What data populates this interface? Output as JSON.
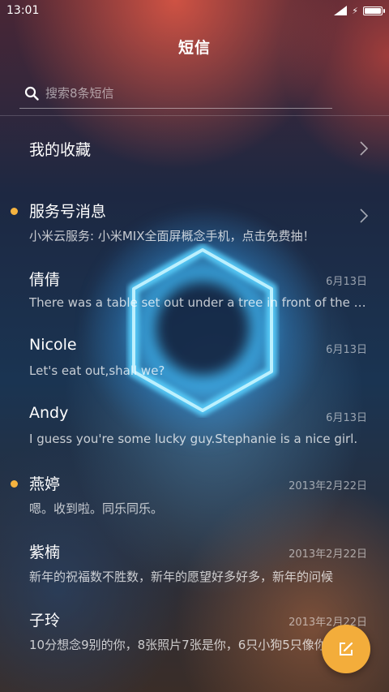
{
  "status_bar": {
    "time": "13:01",
    "charge_symbol": "⚡"
  },
  "header": {
    "title": "短信"
  },
  "search": {
    "placeholder": "搜索8条短信"
  },
  "favorites": {
    "label": "我的收藏"
  },
  "messages": [
    {
      "name": "服务号消息",
      "preview": "小米云服务: 小米MIX全面屏概念手机，点击免费抽！",
      "date": "",
      "unread": true,
      "chevron": true
    },
    {
      "name": "倩倩",
      "preview": "There was a table set out under a tree in front of the house",
      "date": "6月13日",
      "unread": false
    },
    {
      "name": "Nicole",
      "preview": "Let's eat out,shall we?",
      "date": "6月13日",
      "unread": false
    },
    {
      "name": "Andy",
      "preview": "I guess you're some lucky guy.Stephanie is a nice girl.",
      "date": "6月13日",
      "unread": false
    },
    {
      "name": "燕婷",
      "preview": "嗯。收到啦。同乐同乐。",
      "date": "2013年2月22日",
      "unread": true
    },
    {
      "name": "紫楠",
      "preview": "新年的祝福数不胜数，新年的愿望好多好多，新年的问候",
      "date": "2013年2月22日",
      "unread": false
    },
    {
      "name": "子玲",
      "preview": "10分想念9别的你，8张照片7张是你，6只小狗5只像你",
      "date": "2013年2月22日",
      "unread": false
    }
  ],
  "colors": {
    "accent": "#f3ad3b",
    "unread_dot": "#f5b33f"
  },
  "icons": {
    "search": "search-icon",
    "chevron": "chevron-right-icon",
    "compose": "compose-icon",
    "battery": "battery-icon",
    "signal": "signal-icon"
  }
}
